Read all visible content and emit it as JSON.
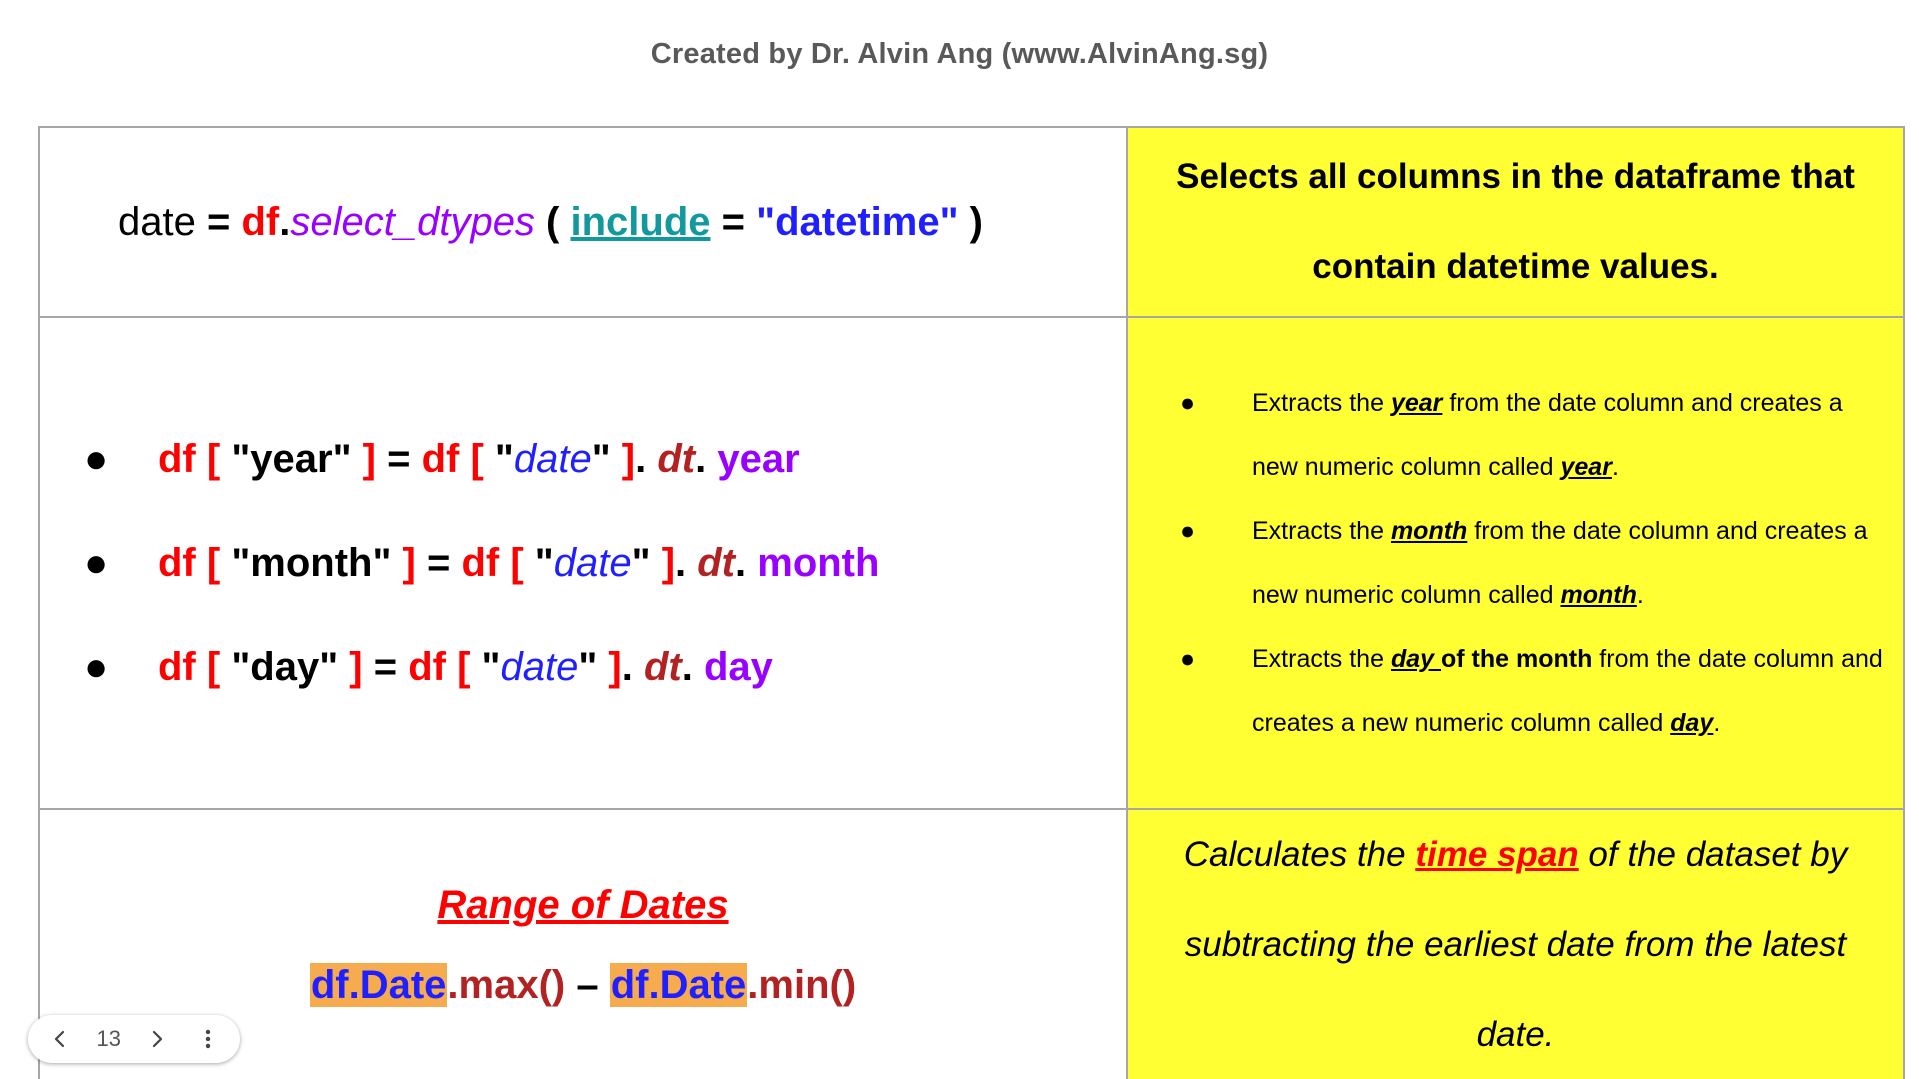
{
  "header": {
    "credit": "Created by Dr. Alvin Ang (www.AlvinAng.sg)"
  },
  "row1": {
    "code": {
      "var": "date",
      "eq": " = ",
      "obj": "df",
      "dot": ".",
      "method": "select_dtypes",
      "open": " ( ",
      "param": "include",
      "eq2": " = ",
      "value": "\"datetime\"",
      "close": " )"
    },
    "description": "Selects all columns in the dataframe that contain datetime values."
  },
  "row2": {
    "bullet_glyph": "●",
    "code_items": [
      {
        "df1": "df",
        "lb1": " [ ",
        "key": "\"year\"",
        "rb1": " ]",
        "eq": " = ",
        "df2": "df",
        "lb2": " [ ",
        "q1": "\"",
        "col": "date",
        "q2": "\"",
        "rb2": " ]",
        "dot1": ". ",
        "dt": "dt",
        "dot2": ". ",
        "attr": "year"
      },
      {
        "df1": "df",
        "lb1": " [ ",
        "key": "\"month\"",
        "rb1": " ]",
        "eq": " = ",
        "df2": "df",
        "lb2": " [ ",
        "q1": "\"",
        "col": "date",
        "q2": "\"",
        "rb2": " ]",
        "dot1": ". ",
        "dt": "dt",
        "dot2": ". ",
        "attr": "month"
      },
      {
        "df1": "df",
        "lb1": " [ ",
        "key": "\"day\"",
        "rb1": " ]",
        "eq": " = ",
        "df2": "df",
        "lb2": " [ ",
        "q1": "\"",
        "col": "date",
        "q2": "\"",
        "rb2": " ]",
        "dot1": ". ",
        "dt": "dt",
        "dot2": ". ",
        "attr": "day"
      }
    ],
    "desc_items": [
      {
        "pre": "Extracts the ",
        "em1": "year",
        "em1_tail": "",
        "bold_tail": "",
        "mid": " from the date column and creates a new numeric column called ",
        "em2": "year",
        "end": "."
      },
      {
        "pre": "Extracts the ",
        "em1": "month",
        "em1_tail": "",
        "bold_tail": "",
        "mid": " from the date column and creates a new numeric column called ",
        "em2": "month",
        "end": "."
      },
      {
        "pre": "Extracts the ",
        "em1": "day",
        "em1_tail": " ",
        "bold_tail": "of the month",
        "mid": " from the date column and creates a new numeric column called ",
        "em2": "day",
        "end": "."
      }
    ]
  },
  "row3": {
    "title": "Range of Dates",
    "expr": {
      "hl1": "df.Date",
      "call1": ".max()",
      "minus": " –  ",
      "hl2": "df.Date",
      "call2": ".min()"
    },
    "description": {
      "pre": "Calculates the ",
      "emph": "time span",
      "post": " of the dataset by subtracting the earliest date from the latest date."
    }
  },
  "pager": {
    "page_number": "13",
    "prev_icon": "‹",
    "next_icon": "›",
    "more_icon": "⋮"
  },
  "colors": {
    "yellow": "#ffff33",
    "highlight": "#f6ab4f",
    "red": "#ff0000",
    "blue": "#1f1fff",
    "purple": "#9900ff"
  }
}
